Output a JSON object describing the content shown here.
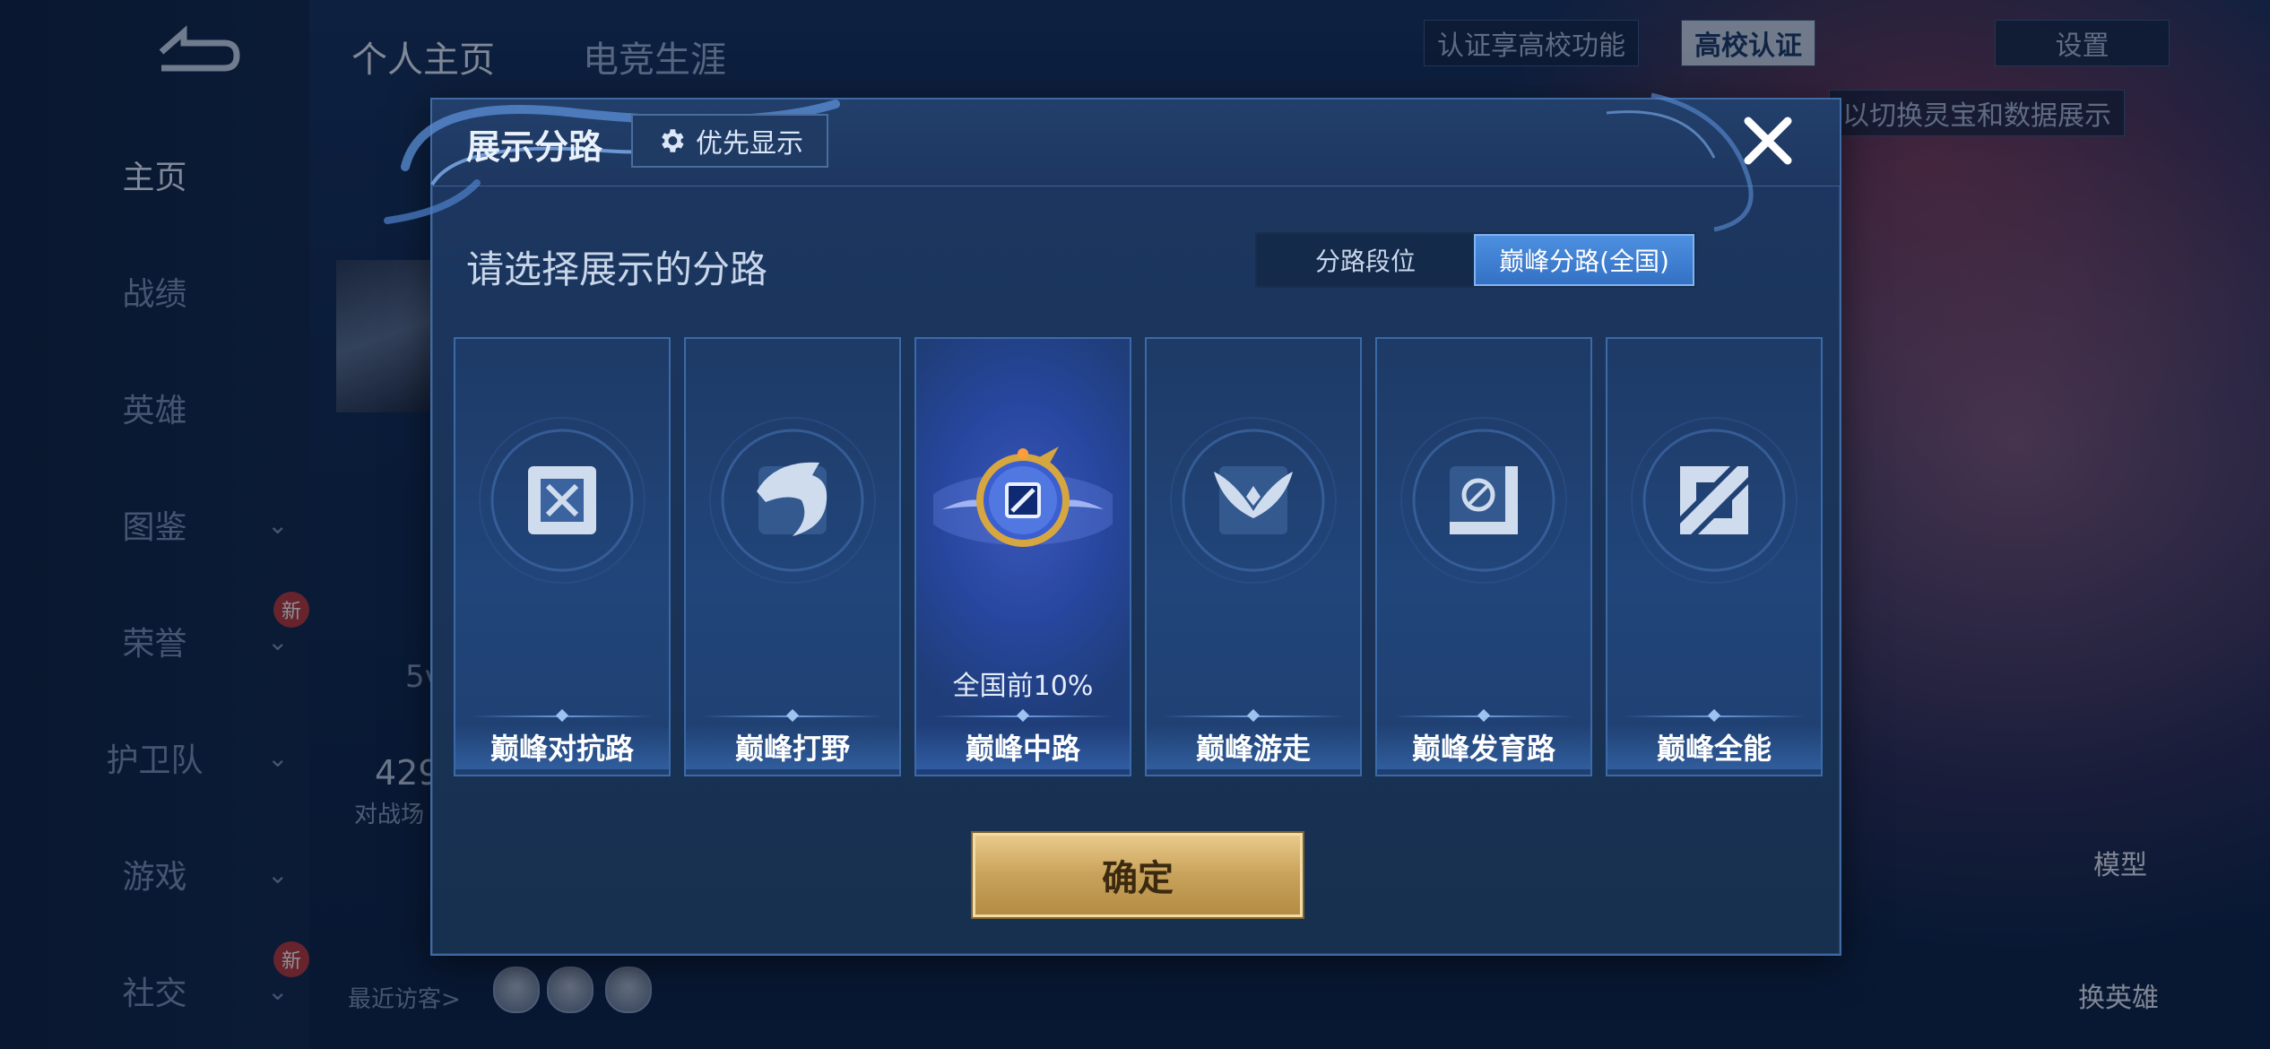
{
  "background": {
    "sidebar": {
      "items": [
        {
          "label": "主页",
          "active": true
        },
        {
          "label": "战绩"
        },
        {
          "label": "英雄"
        },
        {
          "label": "图鉴"
        },
        {
          "label": "荣誉"
        },
        {
          "label": "护卫队"
        },
        {
          "label": "游戏"
        },
        {
          "label": "社交"
        }
      ],
      "new_badge": "新"
    },
    "top_tabs": [
      "个人主页",
      "电竞生涯"
    ],
    "top_right": {
      "cert_text": "认证享高校功能",
      "school_cert": "高校认证",
      "settings": "设置",
      "hint": "以切换灵宝和数据展示"
    },
    "profile": {
      "games_count": "429",
      "games_label": "对战场",
      "level_text": "5v"
    },
    "visitors_label": "最近访客>",
    "right_actions": [
      "模型",
      "换英雄"
    ]
  },
  "dialog": {
    "title": "展示分路",
    "priority_button": "优先显示",
    "prompt": "请选择展示的分路",
    "toggle": {
      "options": [
        "分路段位",
        "巅峰分路(全国)"
      ],
      "selected": 1
    },
    "cards": [
      {
        "label": "巅峰对抗路",
        "icon": "sword-cross-icon"
      },
      {
        "label": "巅峰打野",
        "icon": "dragon-icon"
      },
      {
        "label": "巅峰中路",
        "icon": "mid-lane-badge-icon",
        "selected": true,
        "rank": "全国前10%"
      },
      {
        "label": "巅峰游走",
        "icon": "wings-icon"
      },
      {
        "label": "巅峰发育路",
        "icon": "target-icon"
      },
      {
        "label": "巅峰全能",
        "icon": "all-round-icon"
      }
    ],
    "confirm": "确定",
    "accent_color": "#3471c4",
    "gold_color": "#c8a25a"
  }
}
